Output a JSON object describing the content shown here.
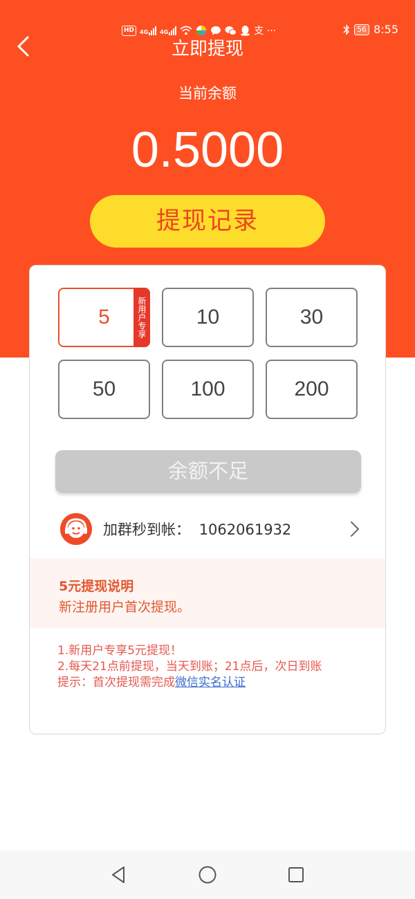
{
  "status_bar": {
    "hd_label": "HD",
    "net1": "4G",
    "net2": "4G",
    "apps_label": "支 ···",
    "battery": "56",
    "time": "8:55"
  },
  "header": {
    "title": "立即提现",
    "balance_label": "当前余额",
    "balance_value": "0.5000",
    "record_button": "提现记录"
  },
  "amounts": [
    {
      "value": "5",
      "tag": "新用户专享",
      "selected": true
    },
    {
      "value": "10"
    },
    {
      "value": "30"
    },
    {
      "value": "50"
    },
    {
      "value": "100"
    },
    {
      "value": "200"
    }
  ],
  "submit_button": "余额不足",
  "group": {
    "label": "加群秒到帐：",
    "number": "1062061932"
  },
  "description": {
    "title": "5元提现说明",
    "text": "新注册用户首次提现。"
  },
  "notes": {
    "line1": "1.新用户专享5元提现！",
    "line2": "2.每天21点前提现，当天到账；21点后，次日到账",
    "line3_prefix": "提示：首次提现需完成",
    "line3_link": "微信实名认证"
  },
  "colors": {
    "primary": "#fe4f22",
    "record_button_bg": "#fedc2b",
    "selected_border": "#e5512b",
    "tag_bg": "#e6382a",
    "disabled_button": "#c9c9c9",
    "link": "#3c6ccf"
  },
  "icons": {
    "back": "chevron-left-icon",
    "group_avatar": "customer-service-icon",
    "group_chevron": "chevron-right-icon",
    "nav_back": "triangle-back-icon",
    "nav_home": "circle-home-icon",
    "nav_recent": "square-recent-icon"
  }
}
